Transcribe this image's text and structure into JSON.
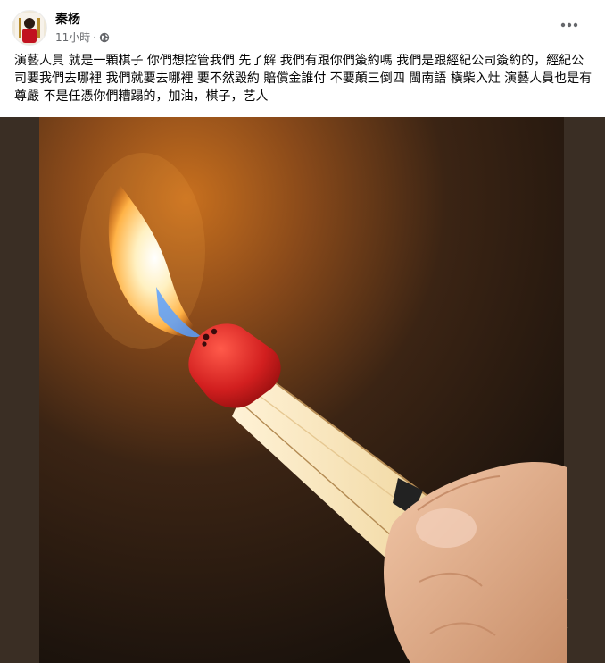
{
  "post": {
    "author_name": "秦杨",
    "timestamp": "11小時",
    "privacy_icon": "globe-icon",
    "more_icon": "more-dots-icon",
    "text": "演藝人員 就是一顆棋子 你們想控管我們 先了解 我們有跟你們簽約嗎 我們是跟經紀公司簽約的，經紀公司要我們去哪裡 我們就要去哪裡 要不然毀約 賠償金誰付 不要顛三倒四 閩南語 橫柴入灶 演藝人員也是有尊嚴 不是任憑你們糟蹋的，加油，棋子，艺人"
  },
  "colors": {
    "meta_text": "#65676b",
    "photo_border": "#3a2e24",
    "match_head": "#d21f1f",
    "flame": "#ffb347"
  }
}
